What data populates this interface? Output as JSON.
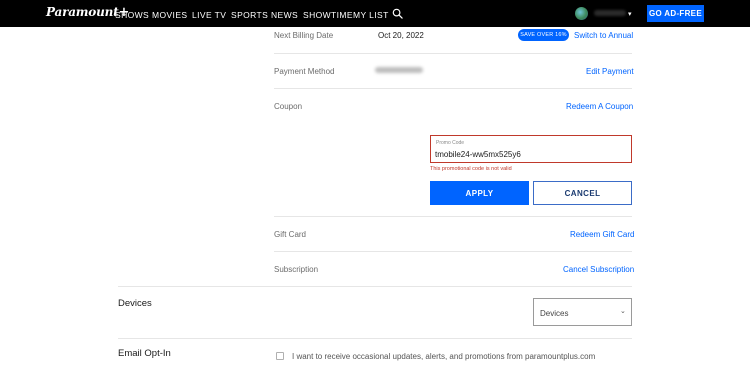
{
  "topbar": {
    "logo_text": "Paramount",
    "logo_plus": "+",
    "nav": [
      "SHOWS",
      "MOVIES",
      "LIVE TV",
      "SPORTS",
      "NEWS",
      "SHOWTIME",
      "MY LIST"
    ],
    "cta_label": "GO AD-FREE",
    "icons": {
      "search": "search-icon",
      "caret": "▾"
    }
  },
  "billing": {
    "next_billing_label": "Next Billing Date",
    "next_billing_value": "Oct 20, 2022",
    "badge": "SAVE OVER 16%",
    "switch_link": "Switch to Annual",
    "payment_label": "Payment Method",
    "payment_link": "Edit Payment",
    "coupon_label": "Coupon",
    "coupon_link": "Redeem A Coupon",
    "promo": {
      "field_label": "Promo Code",
      "value": "tmobile24-ww5mx525y6",
      "error": "This promotional code is not valid",
      "apply_label": "APPLY",
      "cancel_label": "CANCEL"
    },
    "gift_label": "Gift Card",
    "gift_link": "Redeem Gift Card",
    "subscription_label": "Subscription",
    "subscription_link": "Cancel Subscription"
  },
  "devices": {
    "title": "Devices",
    "select_value": "Devices",
    "chevron": "⌄"
  },
  "email_optin": {
    "title": "Email Opt-In",
    "checkbox_label": "I want to receive occasional updates, alerts, and promotions from paramountplus.com"
  },
  "colors": {
    "brand_blue": "#0064ff",
    "error_red": "#c0392b",
    "topbar_bg": "#000000"
  }
}
